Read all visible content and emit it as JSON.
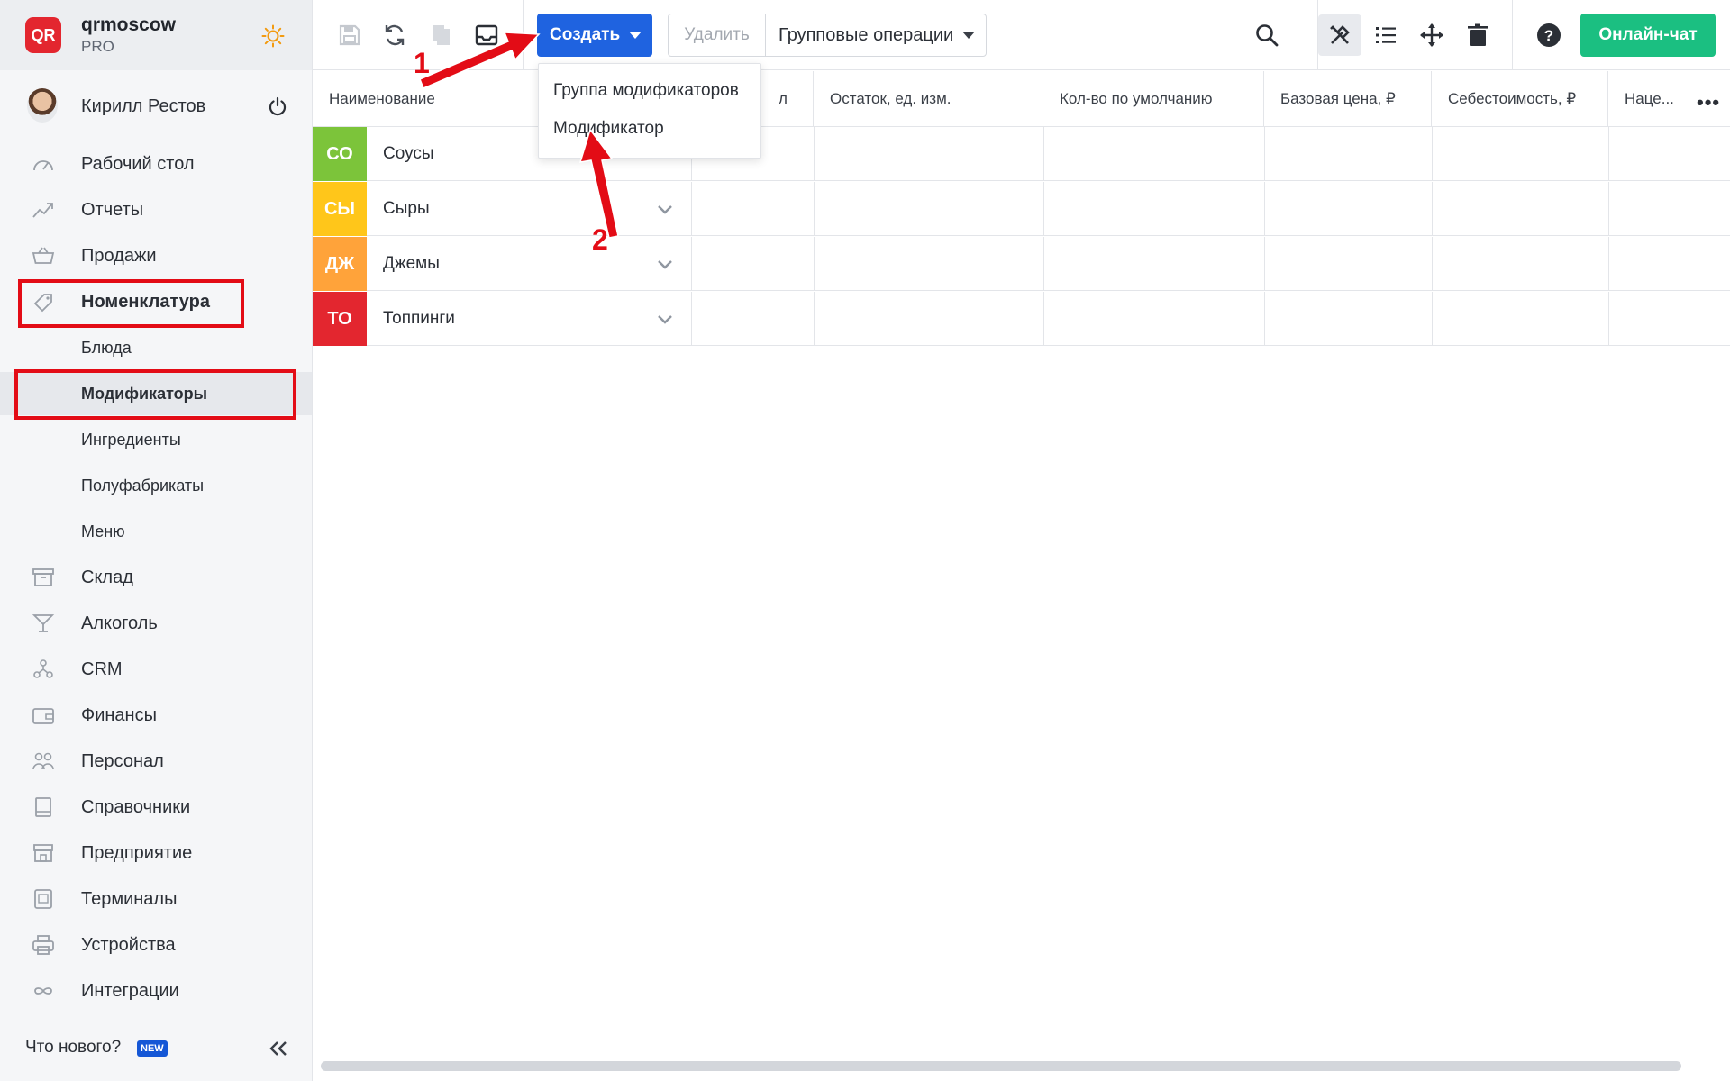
{
  "org": {
    "logo": "QR",
    "name": "qrmoscow",
    "plan": "PRO",
    "theme_icon": "sun-icon"
  },
  "user": {
    "name": "Кирилл Рестов"
  },
  "nav": [
    {
      "label": "Рабочий стол",
      "icon": "dashboard-icon"
    },
    {
      "label": "Отчеты",
      "icon": "chart-icon"
    },
    {
      "label": "Продажи",
      "icon": "basket-icon"
    },
    {
      "label": "Номенклатура",
      "icon": "tag-icon"
    },
    {
      "label": "Блюда"
    },
    {
      "label": "Модификаторы"
    },
    {
      "label": "Ингредиенты"
    },
    {
      "label": "Полуфабрикаты"
    },
    {
      "label": "Меню"
    },
    {
      "label": "Склад",
      "icon": "warehouse-icon"
    },
    {
      "label": "Алкоголь",
      "icon": "cocktail-icon"
    },
    {
      "label": "CRM",
      "icon": "crm-icon"
    },
    {
      "label": "Финансы",
      "icon": "wallet-icon"
    },
    {
      "label": "Персонал",
      "icon": "people-icon"
    },
    {
      "label": "Справочники",
      "icon": "book-icon"
    },
    {
      "label": "Предприятие",
      "icon": "store-icon"
    },
    {
      "label": "Терминалы",
      "icon": "qr-terminal-icon"
    },
    {
      "label": "Устройства",
      "icon": "printer-icon"
    },
    {
      "label": "Интеграции",
      "icon": "infinity-icon"
    }
  ],
  "footer": {
    "whats_new": "Что нового?",
    "badge": "NEW"
  },
  "toolbar": {
    "create": "Создать",
    "delete": "Удалить",
    "bulk": "Групповые операции",
    "chat": "Онлайн-чат"
  },
  "dropdown": [
    "Группа модификаторов",
    "Модификатор"
  ],
  "table": {
    "headers": [
      "Наименование",
      "л",
      "Остаток, ед. изм.",
      "Кол-во по умолчанию",
      "Базовая цена, ₽",
      "Себестоимость, ₽",
      "Наце..."
    ],
    "rows": [
      {
        "abbr": "СО",
        "name": "Соусы",
        "color": "#7cc43a"
      },
      {
        "abbr": "СЫ",
        "name": "Сыры",
        "color": "#ffc61a"
      },
      {
        "abbr": "ДЖ",
        "name": "Джемы",
        "color": "#ffa33a"
      },
      {
        "abbr": "ТО",
        "name": "Топпинги",
        "color": "#e3262f"
      }
    ]
  },
  "annotations": [
    "1",
    "2"
  ],
  "colors": {
    "accent": "#1f63e0",
    "chat": "#1bbf81",
    "highlight": "#e30c16"
  }
}
